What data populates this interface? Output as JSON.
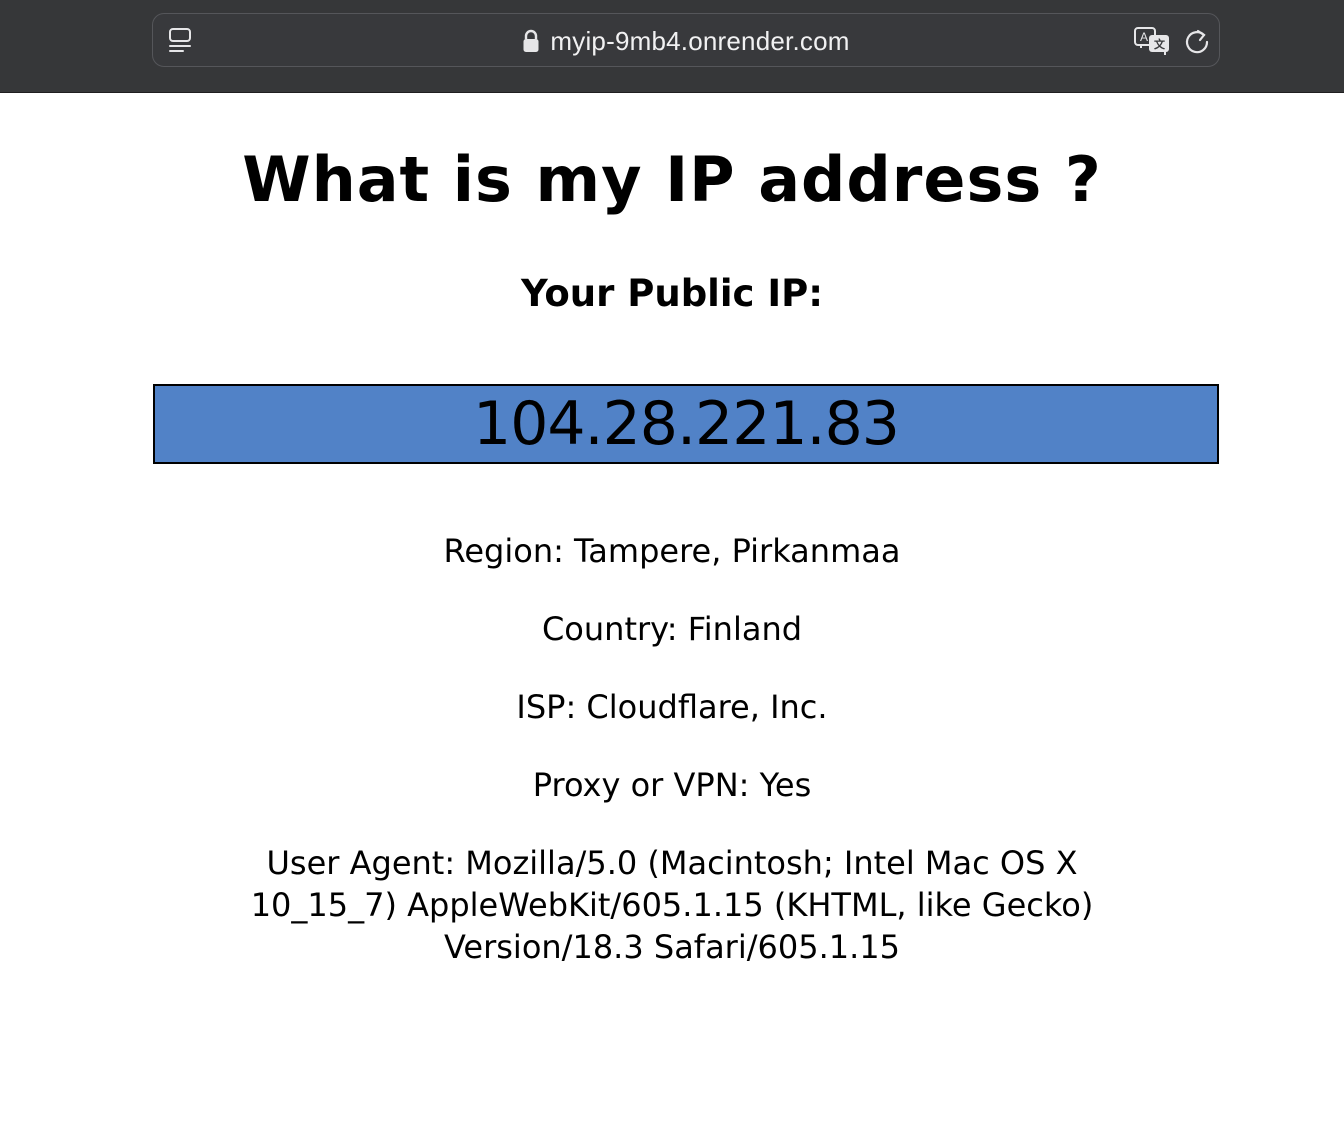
{
  "browser": {
    "url": "myip-9mb4.onrender.com",
    "icons": {
      "sidebar": "sidebar-toggle-icon",
      "lock": "lock-icon",
      "translate": "translate-icon",
      "reload": "reload-icon"
    }
  },
  "page": {
    "title": "What is my IP address ?",
    "ip_label": "Your Public IP:",
    "ip_value": "104.28.221.83",
    "ip_box_color": "#5182c7",
    "info": {
      "region": "Region: Tampere, Pirkanmaa",
      "country": "Country: Finland",
      "isp": "ISP: Cloudflare, Inc.",
      "proxy": "Proxy or VPN: Yes",
      "user_agent": "User Agent: Mozilla/5.0 (Macintosh; Intel Mac OS X 10_15_7) AppleWebKit/605.1.15 (KHTML, like Gecko) Version/18.3 Safari/605.1.15"
    }
  }
}
